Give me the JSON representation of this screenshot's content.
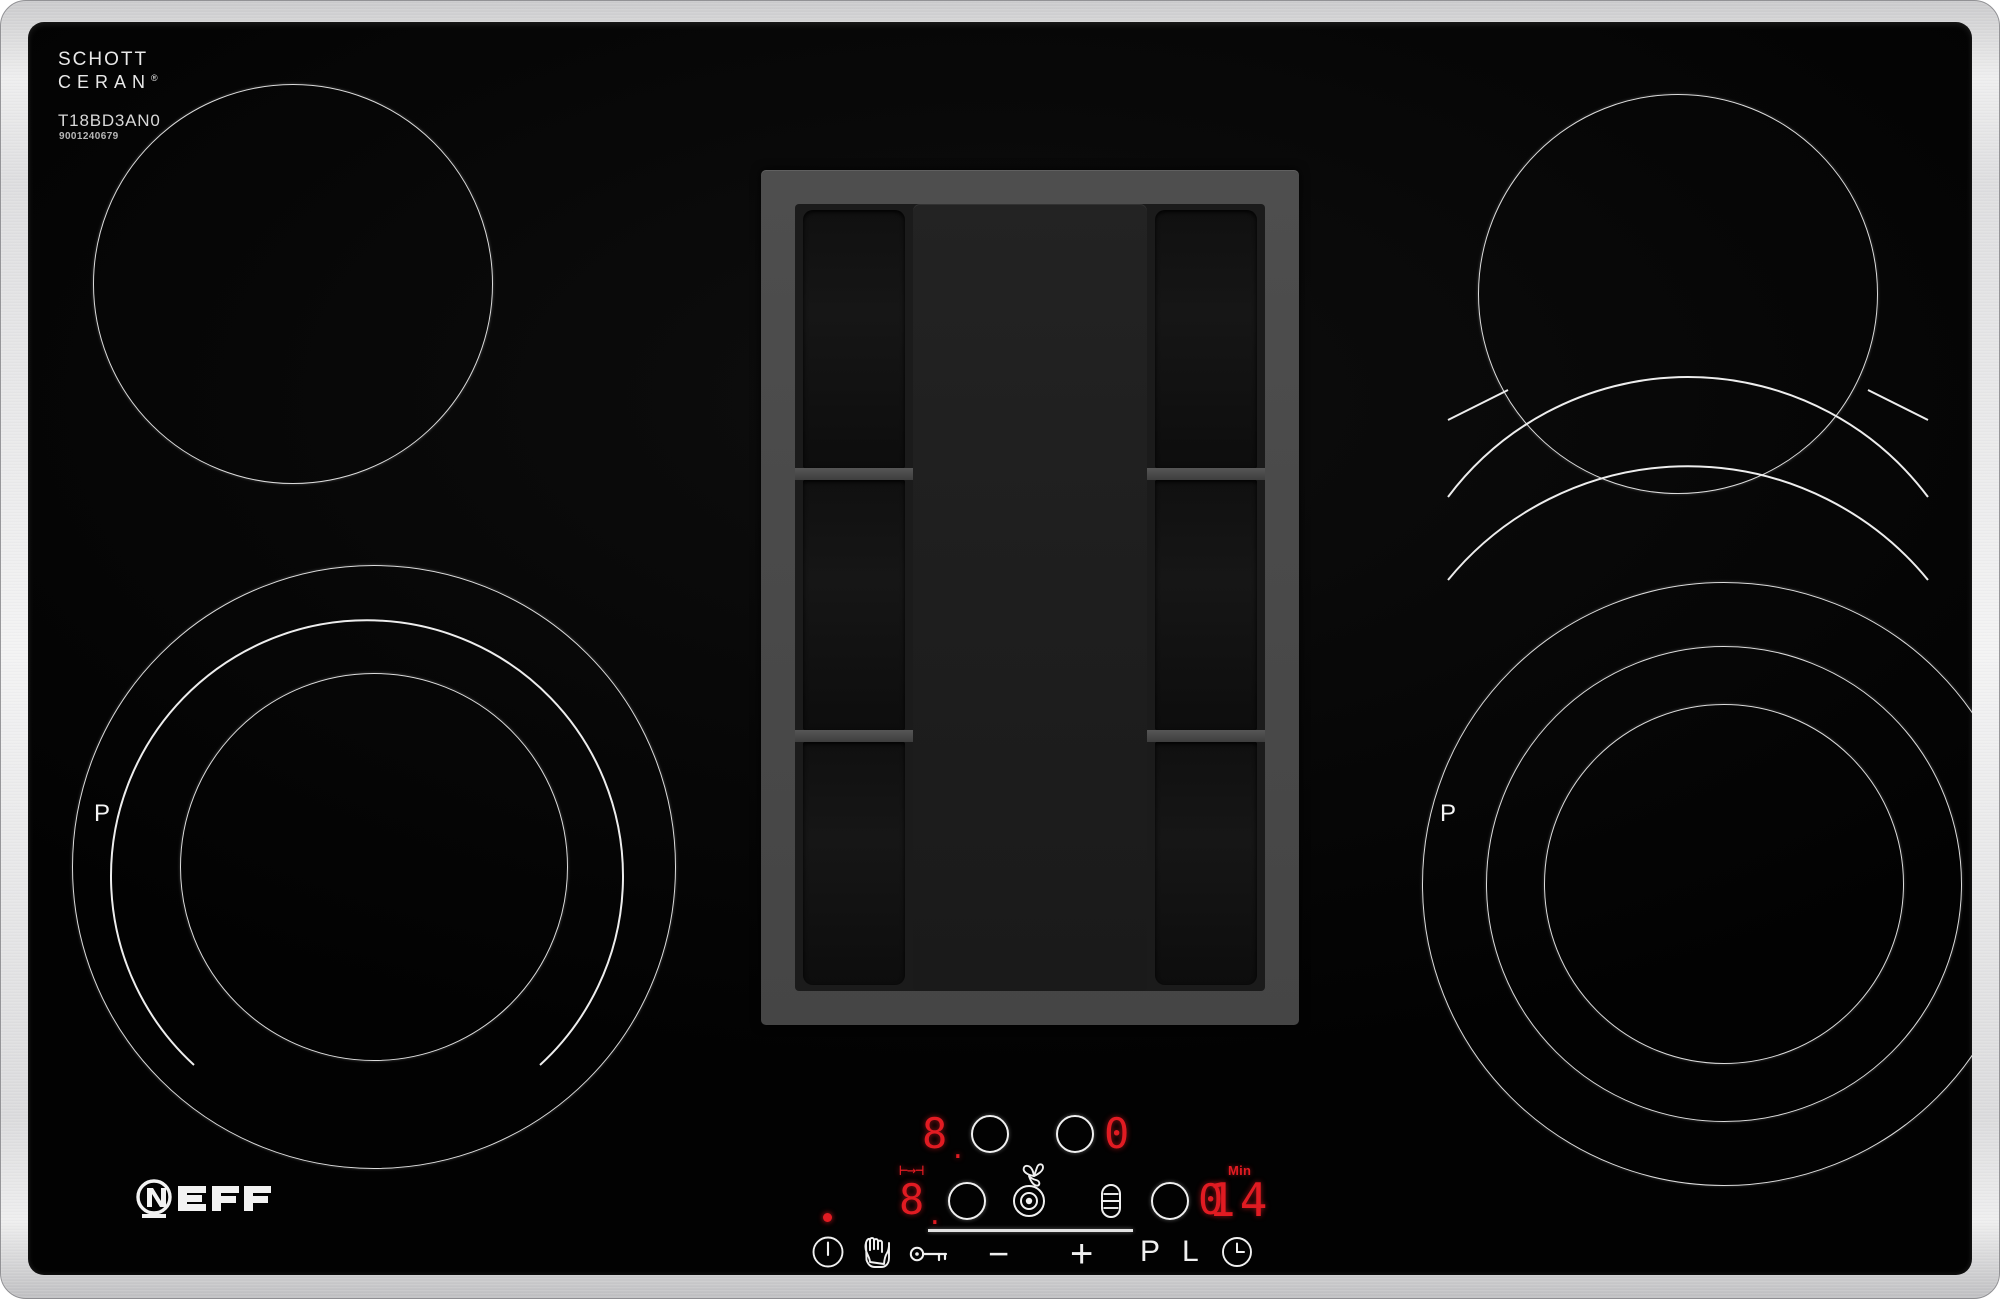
{
  "appliance": {
    "brand": "NEFF",
    "surface_brand_line1": "SCHOTT",
    "surface_brand_line2": "CERAN",
    "surface_brand_reg": "®",
    "model_number": "T18BD3AN0",
    "serial_number": "9001240679",
    "colors": {
      "glass": "#070707",
      "frame": "#d6d6d8",
      "zone_outline": "#f0f0f0",
      "display_red": "#e11b22",
      "vent_frame": "#4a4a4a",
      "vent_slot": "#111111"
    }
  },
  "cooking_zones": [
    {
      "id": "front-left",
      "name": "Front left flex zone",
      "power_boost_label": "P",
      "has_power_boost": true
    },
    {
      "id": "rear-left",
      "name": "Rear left zone",
      "power_boost_label": "",
      "has_power_boost": false
    },
    {
      "id": "rear-right",
      "name": "Rear right flex zone",
      "power_boost_label": "",
      "has_power_boost": false
    },
    {
      "id": "front-right",
      "name": "Front right flex zone",
      "power_boost_label": "P",
      "has_power_boost": true
    }
  ],
  "vent": {
    "name": "Integrated downdraft extractor",
    "grille_slot_count": 3
  },
  "control_panel": {
    "power": {
      "icon": "power-icon",
      "label": ""
    },
    "wipe_protect": {
      "icon": "wipe-protection-hand-icon",
      "label": ""
    },
    "child_lock": {
      "icon": "key-lock-icon",
      "label": ""
    },
    "minus": {
      "icon": "minus-icon",
      "label": "−"
    },
    "plus": {
      "icon": "plus-icon",
      "label": "+"
    },
    "power_boost": {
      "icon": "power-boost-icon",
      "label": "P"
    },
    "keep_warm": {
      "icon": "keep-warm-icon",
      "label": "L"
    },
    "timer": {
      "icon": "clock-icon",
      "label": ""
    },
    "fan": {
      "icon": "fan-icon",
      "label": ""
    },
    "combi_zone": {
      "icon": "combi-zone-icon",
      "label": ""
    },
    "grill_zone": {
      "icon": "grill-zone-icon",
      "label": ""
    },
    "bridge_indicator": {
      "icon": "bridge-link-icon",
      "label": "⊢→⊣"
    },
    "status_dot": {
      "icon": "status-dot-indicator",
      "color": "#e11b22"
    },
    "displays": {
      "rear_left": {
        "value": "8",
        "decimal": true
      },
      "rear_right": {
        "value": "0",
        "decimal": false
      },
      "front_left": {
        "value": "8",
        "decimal": true
      },
      "front_right": {
        "value": "0",
        "decimal": false
      },
      "timer_value": "14",
      "timer_unit": "Min"
    }
  }
}
